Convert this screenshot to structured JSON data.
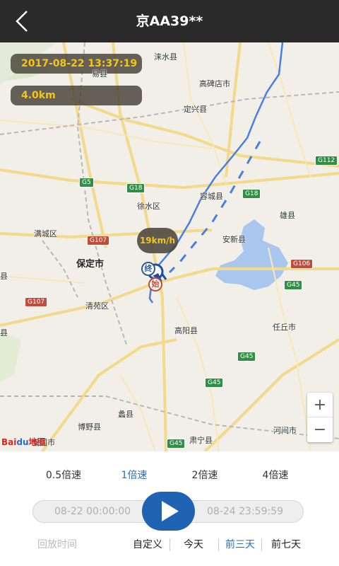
{
  "header": {
    "title": "京AA39**",
    "back_icon": "chevron-left-icon"
  },
  "map": {
    "timestamp": "2017-08-22 13:37:19",
    "distance": "4.0km",
    "speed": "19km/h",
    "end_marker": "终",
    "start_marker": "始",
    "zoom_in": "+",
    "zoom_out": "−",
    "logo_a": "Bai",
    "logo_b": "du",
    "logo_c": "地图",
    "labels": {
      "laishui": "涞水县",
      "yixian": "易县",
      "gaobeidian": "高碑店市",
      "dingxing": "定兴县",
      "xushui": "徐水区",
      "rongcheng": "容城县",
      "xiongxian": "雄县",
      "mancheng": "满城区",
      "anxin": "安新县",
      "baoding": "保定市",
      "qingyuan": "清苑区",
      "renqiu": "任丘市",
      "gaoyang": "高阳县",
      "lixian": "蠡县",
      "boye": "博野县",
      "suning": "肃宁县",
      "hejian": "河间市",
      "anguo": "安国市",
      "ji": "县",
      "xian2": "县"
    },
    "shields": {
      "g112": "G112",
      "g5": "G5",
      "g18a": "G18",
      "g18b": "G18",
      "g107a": "G107",
      "g107b": "G107",
      "g106": "G106",
      "g45a": "G45",
      "g45b": "G45",
      "g45c": "G45",
      "g45d": "G45"
    }
  },
  "playback": {
    "speeds": [
      "0.5倍速",
      "1倍速",
      "2倍速",
      "4倍速"
    ],
    "active_speed": 1,
    "start_time": "08-22 00:00:00",
    "end_time": "08-24 23:59:59",
    "play_icon": "play-icon"
  },
  "range": {
    "label": "回放时间",
    "options": [
      "自定义",
      "今天",
      "前三天",
      "前七天"
    ],
    "active": 2
  },
  "colors": {
    "accent": "#2a70b8",
    "play": "#1f63b2",
    "header": "#2a2a2a",
    "info_text": "#f5c518",
    "track": "#4a7fe0"
  }
}
